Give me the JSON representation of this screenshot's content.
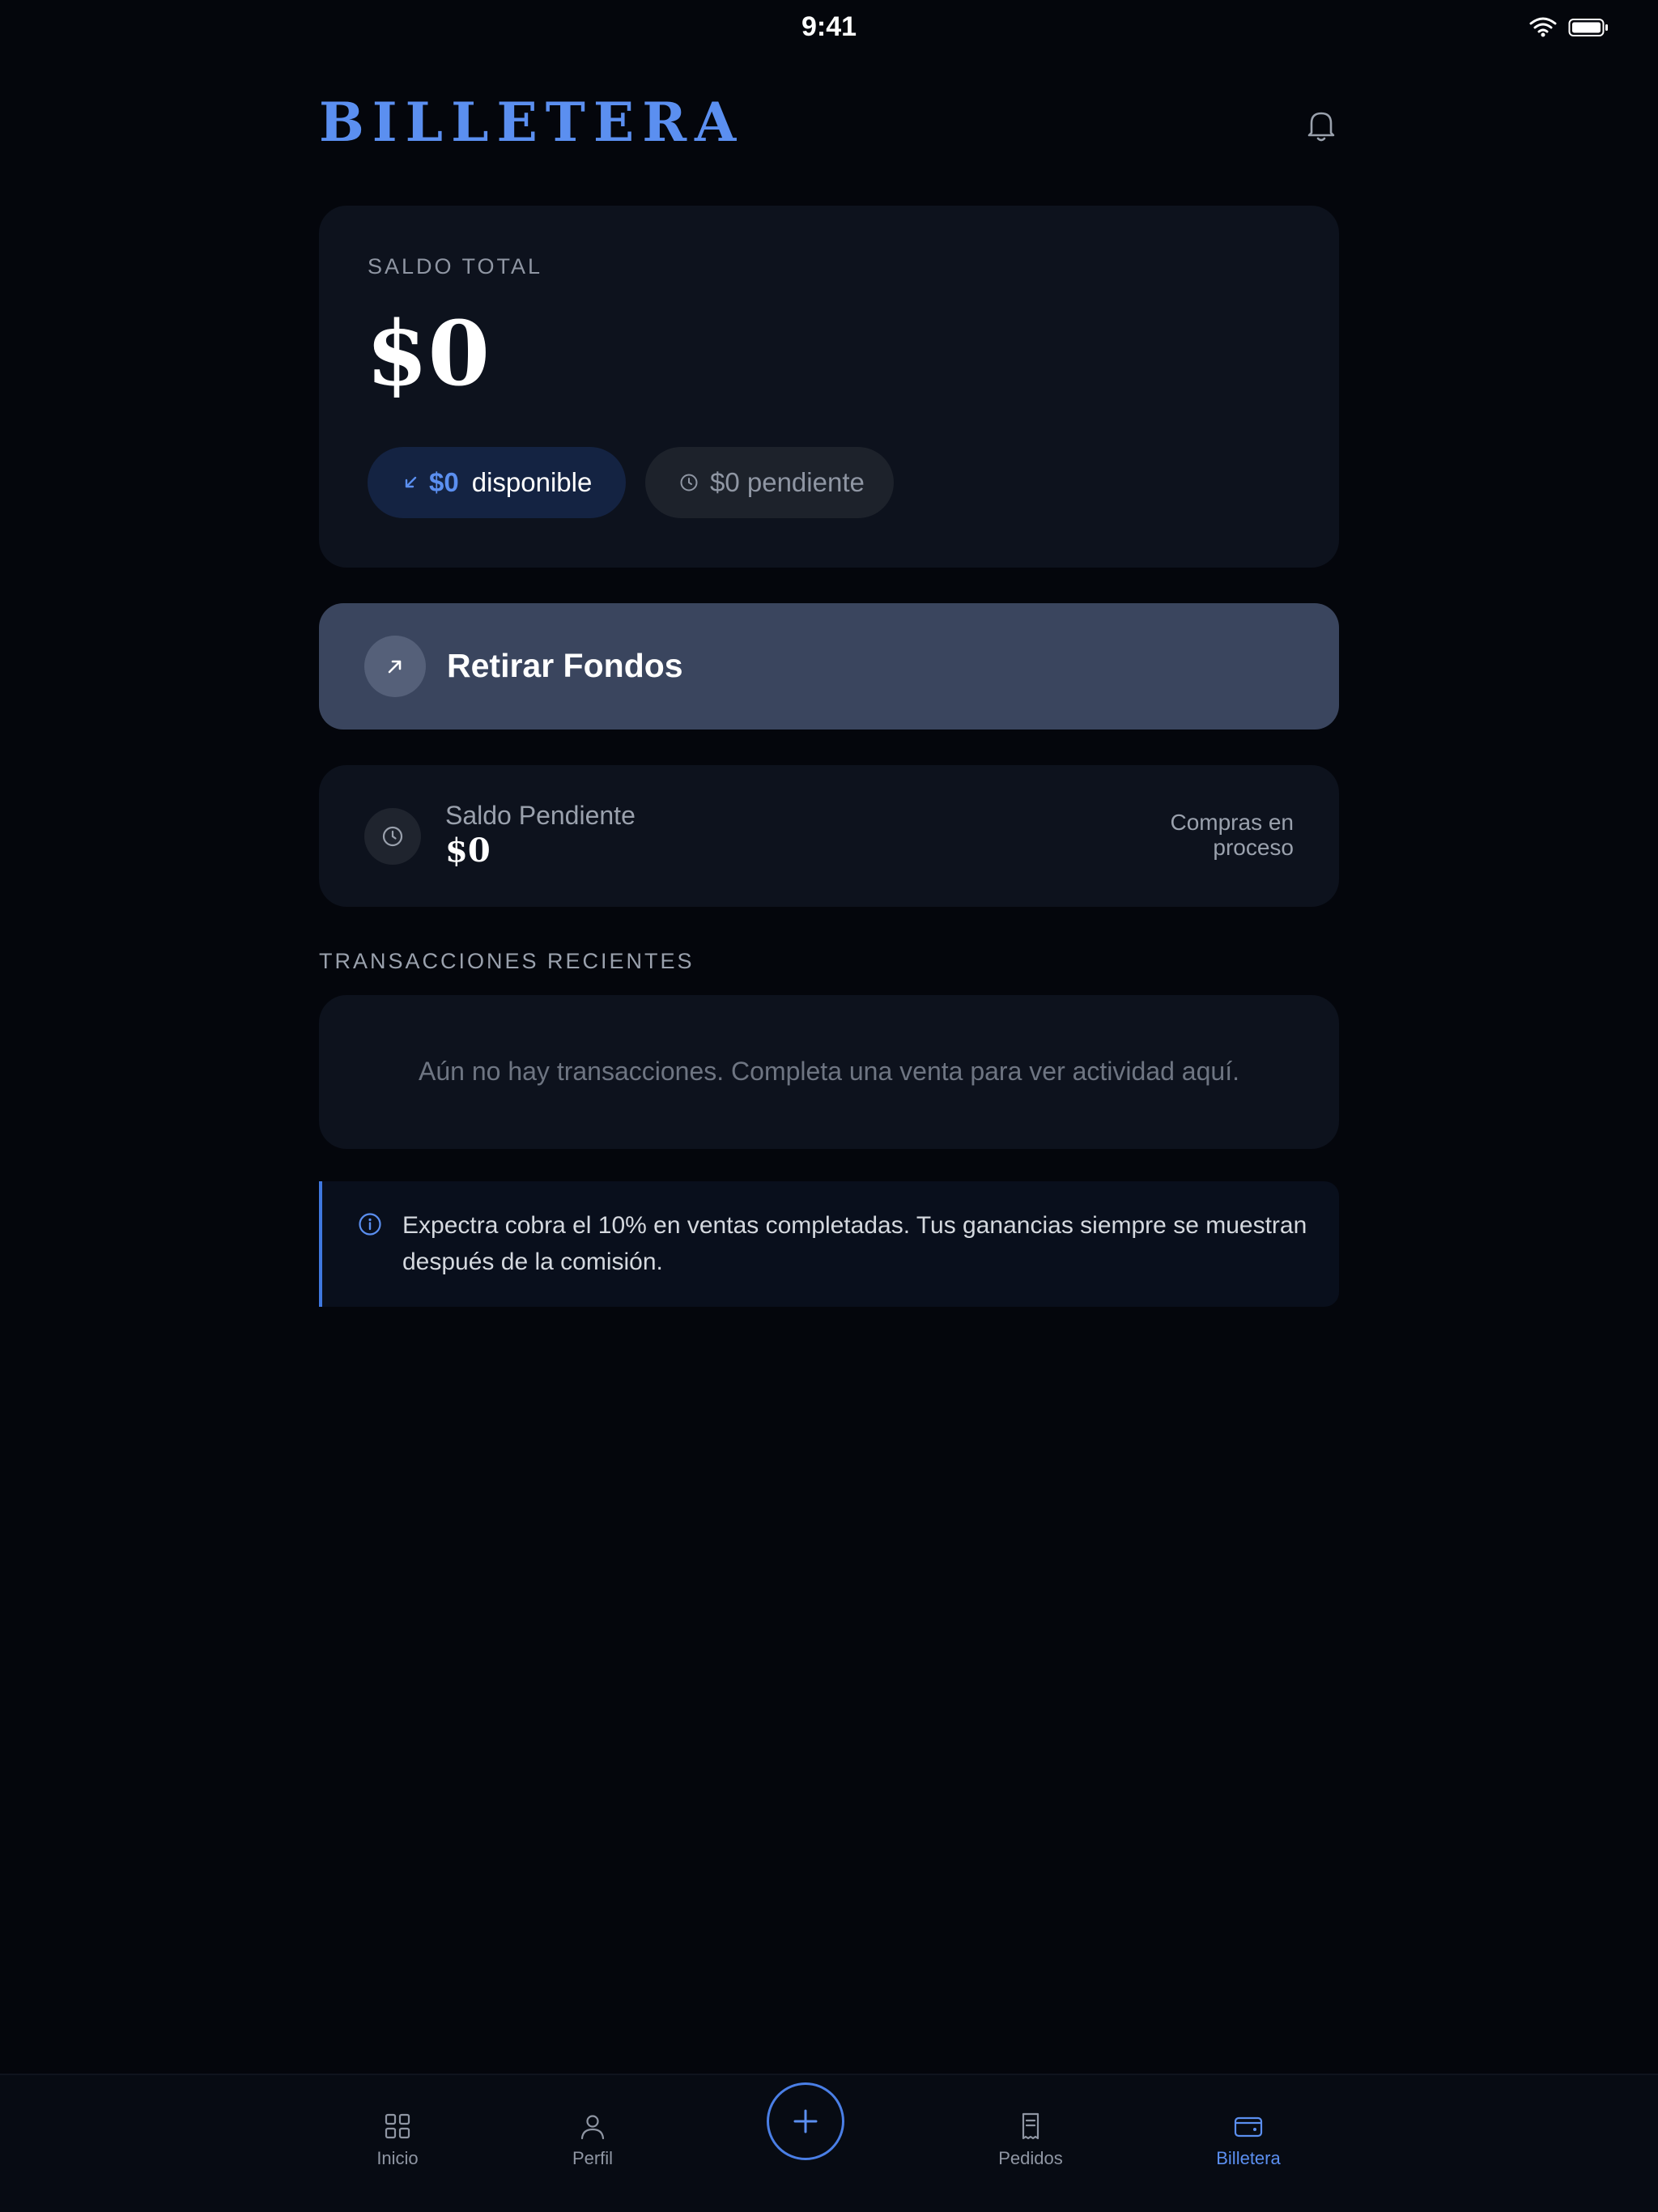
{
  "status_bar": {
    "time": "9:41"
  },
  "header": {
    "title": "BILLETERA"
  },
  "balance": {
    "label": "SALDO TOTAL",
    "amount": "$0",
    "available_amount": "$0",
    "available_label": "disponible",
    "pending_pill": "$0 pendiente"
  },
  "withdraw": {
    "label": "Retirar Fondos"
  },
  "pending": {
    "title": "Saldo Pendiente",
    "amount": "$0",
    "note": "Compras en proceso"
  },
  "transactions": {
    "section_title": "TRANSACCIONES RECIENTES",
    "empty_message": "Aún no hay transacciones. Completa una venta para ver actividad aquí."
  },
  "info": {
    "text": "Expectra cobra el 10% en ventas completadas. Tus ganancias siempre se muestran después de la comisión."
  },
  "tabbar": {
    "items": [
      {
        "label": "Inicio",
        "icon": "grid-icon"
      },
      {
        "label": "Perfil",
        "icon": "person-icon"
      },
      {
        "label": "Pedidos",
        "icon": "receipt-icon"
      },
      {
        "label": "Billetera",
        "icon": "wallet-icon",
        "active": true
      }
    ]
  },
  "colors": {
    "accent": "#5b8ff0",
    "background": "#04060c",
    "card": "#0d121d",
    "withdraw_button": "#3a455e"
  }
}
